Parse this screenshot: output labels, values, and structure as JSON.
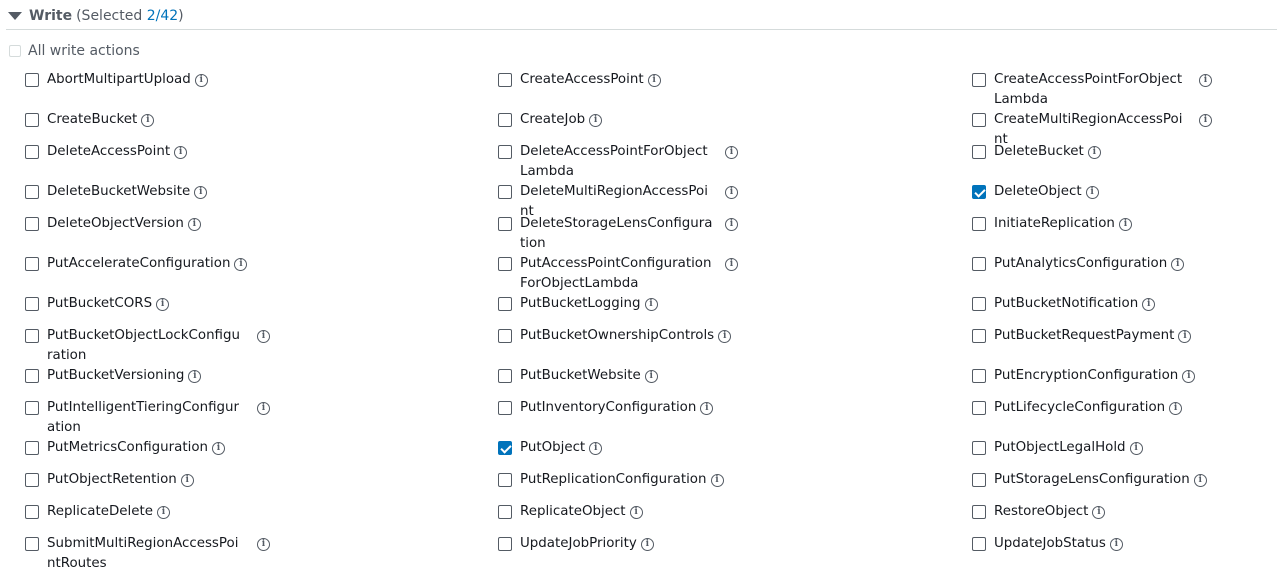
{
  "section": {
    "title": "Write",
    "selected_prefix": "(Selected ",
    "selected_count": "2/42",
    "selected_suffix": ")"
  },
  "all_write_actions": "All write actions",
  "info_glyph": "i",
  "columns": [
    [
      {
        "label": "AbortMultipartUpload",
        "checked": false
      },
      {
        "label": "CreateBucket",
        "checked": false
      },
      {
        "label": "DeleteAccessPoint",
        "checked": false
      },
      {
        "label": "DeleteBucketWebsite",
        "checked": false
      },
      {
        "label": "DeleteObjectVersion",
        "checked": false
      },
      {
        "label": "PutAccelerateConfiguration",
        "checked": false
      },
      {
        "label": "PutBucketCORS",
        "checked": false
      },
      {
        "label": "PutBucketObjectLockConfiguration",
        "checked": false
      },
      {
        "label": "PutBucketVersioning",
        "checked": false
      },
      {
        "label": "PutIntelligentTieringConfiguration",
        "checked": false
      },
      {
        "label": "PutMetricsConfiguration",
        "checked": false
      },
      {
        "label": "PutObjectRetention",
        "checked": false
      },
      {
        "label": "ReplicateDelete",
        "checked": false
      },
      {
        "label": "SubmitMultiRegionAccessPointRoutes",
        "checked": false
      }
    ],
    [
      {
        "label": "CreateAccessPoint",
        "checked": false
      },
      {
        "label": "CreateJob",
        "checked": false
      },
      {
        "label": "DeleteAccessPointForObjectLambda",
        "checked": false
      },
      {
        "label": "DeleteMultiRegionAccessPoint",
        "checked": false
      },
      {
        "label": "DeleteStorageLensConfiguration",
        "checked": false
      },
      {
        "label": "PutAccessPointConfigurationForObjectLambda",
        "checked": false
      },
      {
        "label": "PutBucketLogging",
        "checked": false
      },
      {
        "label": "PutBucketOwnershipControls",
        "checked": false
      },
      {
        "label": "PutBucketWebsite",
        "checked": false
      },
      {
        "label": "PutInventoryConfiguration",
        "checked": false
      },
      {
        "label": "PutObject",
        "checked": true
      },
      {
        "label": "PutReplicationConfiguration",
        "checked": false
      },
      {
        "label": "ReplicateObject",
        "checked": false
      },
      {
        "label": "UpdateJobPriority",
        "checked": false
      }
    ],
    [
      {
        "label": "CreateAccessPointForObjectLambda",
        "checked": false
      },
      {
        "label": "CreateMultiRegionAccessPoint",
        "checked": false
      },
      {
        "label": "DeleteBucket",
        "checked": false
      },
      {
        "label": "DeleteObject",
        "checked": true
      },
      {
        "label": "InitiateReplication",
        "checked": false
      },
      {
        "label": "PutAnalyticsConfiguration",
        "checked": false
      },
      {
        "label": "PutBucketNotification",
        "checked": false
      },
      {
        "label": "PutBucketRequestPayment",
        "checked": false
      },
      {
        "label": "PutEncryptionConfiguration",
        "checked": false
      },
      {
        "label": "PutLifecycleConfiguration",
        "checked": false
      },
      {
        "label": "PutObjectLegalHold",
        "checked": false
      },
      {
        "label": "PutStorageLensConfiguration",
        "checked": false
      },
      {
        "label": "RestoreObject",
        "checked": false
      },
      {
        "label": "UpdateJobStatus",
        "checked": false
      }
    ]
  ]
}
